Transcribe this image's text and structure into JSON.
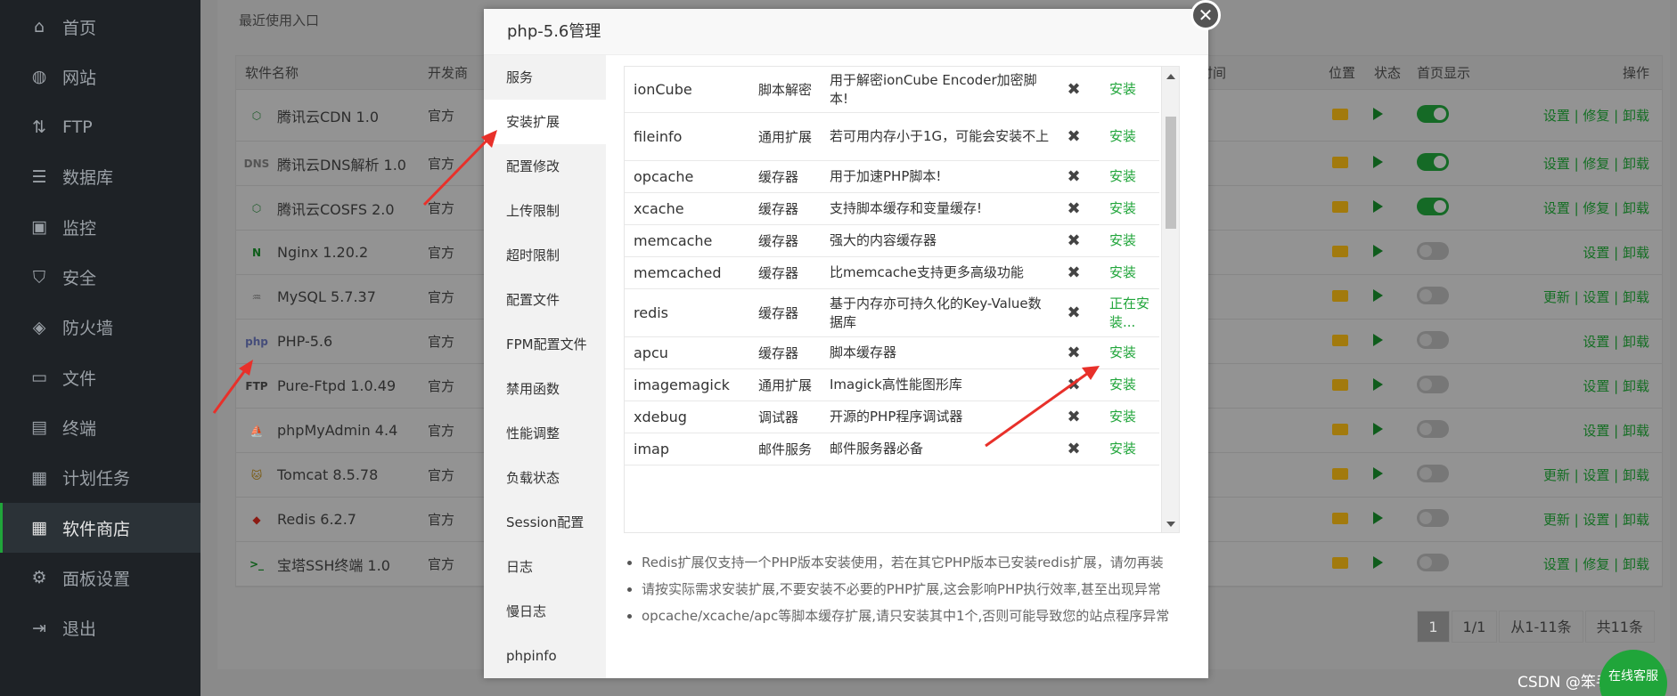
{
  "sidebar": {
    "items": [
      {
        "label": "首页",
        "icon": "home-icon"
      },
      {
        "label": "网站",
        "icon": "globe-icon"
      },
      {
        "label": "FTP",
        "icon": "ftp-icon"
      },
      {
        "label": "数据库",
        "icon": "database-icon"
      },
      {
        "label": "监控",
        "icon": "monitor-icon"
      },
      {
        "label": "安全",
        "icon": "shield-icon"
      },
      {
        "label": "防火墙",
        "icon": "firewall-icon"
      },
      {
        "label": "文件",
        "icon": "folder-icon"
      },
      {
        "label": "终端",
        "icon": "terminal-icon"
      },
      {
        "label": "计划任务",
        "icon": "calendar-icon"
      },
      {
        "label": "软件商店",
        "icon": "grid-icon"
      },
      {
        "label": "面板设置",
        "icon": "settings-icon"
      },
      {
        "label": "退出",
        "icon": "logout-icon"
      }
    ],
    "active_index": 10
  },
  "main": {
    "recent_label": "最近使用入口",
    "table_headers": {
      "name": "软件名称",
      "dev": "开发商",
      "expire": "期时间",
      "loc": "位置",
      "state": "状态",
      "home": "首页显示",
      "ops": "操作"
    },
    "rows": [
      {
        "name": "腾讯云CDN 1.0",
        "dev": "官方",
        "home_on": true,
        "ops": "设置 | 修复 | 卸载",
        "icon": "cdn-icon"
      },
      {
        "name": "腾讯云DNS解析 1.0",
        "dev": "官方",
        "home_on": true,
        "ops": "设置 | 修复 | 卸载",
        "icon": "dns-icon"
      },
      {
        "name": "腾讯云COSFS 2.0",
        "dev": "官方",
        "home_on": true,
        "ops": "设置 | 修复 | 卸载",
        "icon": "cosfs-icon"
      },
      {
        "name": "Nginx 1.20.2",
        "dev": "官方",
        "home_on": false,
        "ops": "设置 | 卸载",
        "icon": "nginx-icon"
      },
      {
        "name": "MySQL 5.7.37",
        "dev": "官方",
        "home_on": false,
        "ops": "更新 | 设置 | 卸载",
        "icon": "mysql-icon"
      },
      {
        "name": "PHP-5.6",
        "dev": "官方",
        "home_on": false,
        "ops": "设置 | 卸载",
        "icon": "php-icon"
      },
      {
        "name": "Pure-Ftpd 1.0.49",
        "dev": "官方",
        "home_on": false,
        "ops": "设置 | 卸载",
        "icon": "ftp-icon"
      },
      {
        "name": "phpMyAdmin 4.4",
        "dev": "官方",
        "home_on": false,
        "ops": "设置 | 卸载",
        "icon": "phpmyadmin-icon"
      },
      {
        "name": "Tomcat 8.5.78",
        "dev": "官方",
        "home_on": false,
        "ops": "更新 | 设置 | 卸载",
        "icon": "tomcat-icon"
      },
      {
        "name": "Redis 6.2.7",
        "dev": "官方",
        "home_on": false,
        "ops": "更新 | 设置 | 卸载",
        "icon": "redis-icon"
      },
      {
        "name": "宝塔SSH终端 1.0",
        "dev": "官方",
        "home_on": false,
        "ops": "设置 | 修复 | 卸载",
        "icon": "ssh-terminal-icon"
      }
    ],
    "pager": {
      "current": "1",
      "pages": "1/1",
      "range": "从1-11条",
      "total": "共11条"
    }
  },
  "modal": {
    "title": "php-5.6管理",
    "close_glyph": "✕",
    "nav": [
      "服务",
      "安装扩展",
      "配置修改",
      "上传限制",
      "超时限制",
      "配置文件",
      "FPM配置文件",
      "禁用函数",
      "性能调整",
      "负载状态",
      "Session配置",
      "日志",
      "慢日志",
      "phpinfo"
    ],
    "nav_active_index": 1,
    "extensions": [
      {
        "name": "ionCube",
        "type": "脚本解密",
        "desc": "用于解密ionCube Encoder加密脚本!",
        "mark": "✖",
        "action": "安装"
      },
      {
        "name": "fileinfo",
        "type": "通用扩展",
        "desc": "若可用内存小于1G，可能会安装不上",
        "mark": "✖",
        "action": "安装"
      },
      {
        "name": "opcache",
        "type": "缓存器",
        "desc": "用于加速PHP脚本!",
        "mark": "✖",
        "action": "安装"
      },
      {
        "name": "xcache",
        "type": "缓存器",
        "desc": "支持脚本缓存和变量缓存!",
        "mark": "✖",
        "action": "安装"
      },
      {
        "name": "memcache",
        "type": "缓存器",
        "desc": "强大的内容缓存器",
        "mark": "✖",
        "action": "安装"
      },
      {
        "name": "memcached",
        "type": "缓存器",
        "desc": "比memcache支持更多高级功能",
        "mark": "✖",
        "action": "安装"
      },
      {
        "name": "redis",
        "type": "缓存器",
        "desc": "基于内存亦可持久化的Key-Value数据库",
        "mark": "✖",
        "action": "正在安装..."
      },
      {
        "name": "apcu",
        "type": "缓存器",
        "desc": "脚本缓存器",
        "mark": "✖",
        "action": "安装"
      },
      {
        "name": "imagemagick",
        "type": "通用扩展",
        "desc": "Imagick高性能图形库",
        "mark": "✖",
        "action": "安装"
      },
      {
        "name": "xdebug",
        "type": "调试器",
        "desc": "开源的PHP程序调试器",
        "mark": "✖",
        "action": "安装"
      },
      {
        "name": "imap",
        "type": "邮件服务",
        "desc": "邮件服务器必备",
        "mark": "✖",
        "action": "安装"
      }
    ],
    "tips": [
      "Redis扩展仅支持一个PHP版本安装使用，若在其它PHP版本已安装redis扩展，请勿再装",
      "请按实际需求安装扩展,不要安装不必要的PHP扩展,这会影响PHP执行效率,甚至出现异常",
      "opcache/xcache/apc等脚本缓存扩展,请只安装其中1个,否则可能导致您的站点程序异常"
    ]
  },
  "watermark": "CSDN @笨手笨脚の",
  "chat_label": "在线客服",
  "colors": {
    "accent": "#20a53a",
    "arrow": "#e8302a",
    "sidebar_bg": "#1e2226"
  }
}
